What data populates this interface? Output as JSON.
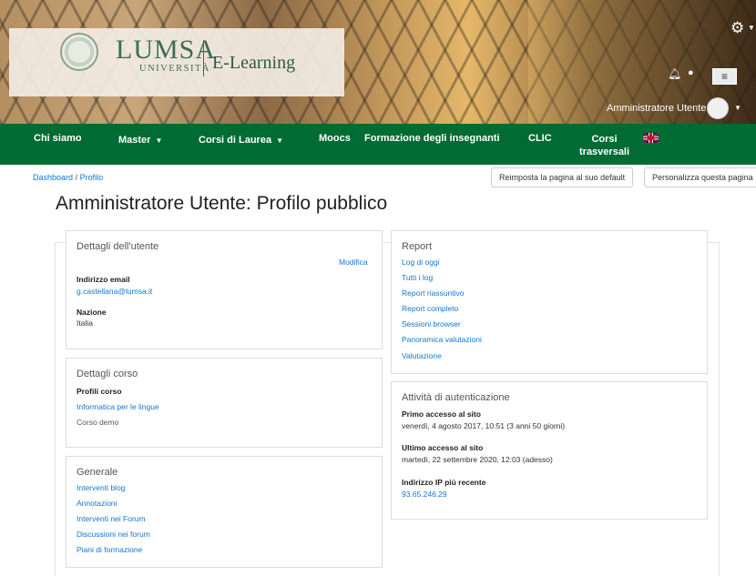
{
  "header": {
    "brand_name": "LUMSA",
    "brand_sub": "UNIVERSITÀ",
    "product": "E-Learning",
    "user_name": "Amministratore Utente",
    "icons": [
      "gear-icon",
      "bell-icon",
      "chat-icon",
      "menu-icon",
      "avatar",
      "chevron-down-icon"
    ]
  },
  "nav": {
    "items": [
      {
        "label": "Chi siamo"
      },
      {
        "label": "Master",
        "caret": "▼"
      },
      {
        "label": "Corsi di Laurea",
        "caret": "▼"
      },
      {
        "label": "Moocs"
      },
      {
        "label": "Formazione degli insegnanti"
      },
      {
        "label": "CLIC"
      },
      {
        "label_line1": "Corsi",
        "label_line2": "trasversali"
      }
    ],
    "language_flag": "uk-flag-icon"
  },
  "breadcrumb": {
    "dashboard": "Dashboard",
    "separator": "/",
    "current": "Profilo"
  },
  "actions": {
    "reset": "Reimposta la pagina al suo default",
    "customize": "Personalizza questa pagina"
  },
  "page_title": "Amministratore Utente: Profilo pubblico",
  "user_details": {
    "title": "Dettagli dell'utente",
    "edit": "Modifica",
    "email_label": "Indirizzo email",
    "email": "g.castellana@lumsa.it",
    "country_label": "Nazione",
    "country": "Italia"
  },
  "course_details": {
    "title": "Dettagli corso",
    "profiles_label": "Profili corso",
    "course_link": "Informatica per le lingue",
    "course_demo": "Corso demo"
  },
  "general": {
    "title": "Generale",
    "links": [
      "Interventi blog",
      "Annotazioni",
      "Interventi nei Forum",
      "Discussioni nei forum",
      "Piani di formazione"
    ]
  },
  "report": {
    "title": "Report",
    "links": [
      "Log di oggi",
      "Tutti i log",
      "Report riassuntivo",
      "Report completo",
      "Sessioni browser",
      "Panoramica valutazioni",
      "Valutazione"
    ]
  },
  "auth": {
    "title": "Attività di autenticazione",
    "first_label": "Primo accesso al sito",
    "first_value": "venerdì, 4 agosto 2017, 10:51  (3 anni 50 giorni)",
    "last_label": "Ultimo accesso al sito",
    "last_value": "martedì, 22 settembre 2020, 12:03  (adesso)",
    "ip_label": "Indirizzo IP più recente",
    "ip_value": "93.65.246.29"
  },
  "colors": {
    "nav_green": "#006b33",
    "link_blue": "#1177d1"
  }
}
